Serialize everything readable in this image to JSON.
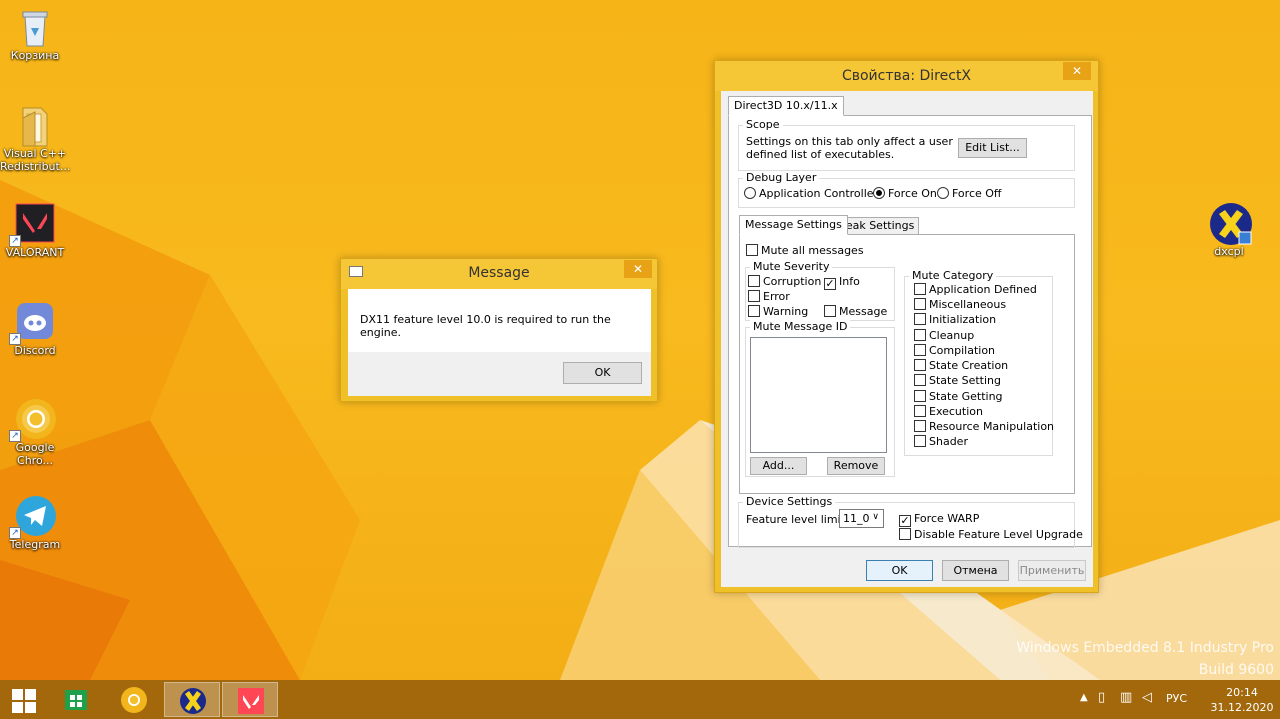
{
  "desktop": {
    "icons": [
      {
        "label": "Корзина"
      },
      {
        "label": "Visual C++ Redistribut..."
      },
      {
        "label": "VALORANT"
      },
      {
        "label": "Discord"
      },
      {
        "label": "Google Chro..."
      },
      {
        "label": "Telegram"
      },
      {
        "label": "dxcpl"
      }
    ],
    "watermark_line1": "Windows Embedded 8.1 Industry Pro",
    "watermark_line2": "Build 9600"
  },
  "message_box": {
    "title": "Message",
    "close": "✕",
    "text": "DX11 feature level 10.0 is required to run the engine.",
    "ok_label": "OK"
  },
  "dx_window": {
    "title": "Свойства: DirectX",
    "close": "✕",
    "main_tab": "Direct3D 10.x/11.x",
    "scope": {
      "label": "Scope",
      "text_line1": "Settings on this tab only affect a user",
      "text_line2": "defined list of executables.",
      "edit_list": "Edit List..."
    },
    "debug_layer": {
      "label": "Debug Layer",
      "options": [
        "Application Controlled",
        "Force On",
        "Force Off"
      ],
      "selected": "Force On"
    },
    "sub_tabs": [
      "Message Settings",
      "Break Settings"
    ],
    "mute_all": "Mute all messages",
    "mute_severity": {
      "label": "Mute Severity",
      "items": [
        {
          "label": "Corruption",
          "checked": false
        },
        {
          "label": "Info",
          "checked": true
        },
        {
          "label": "Error",
          "checked": false
        },
        {
          "label": "Warning",
          "checked": false
        },
        {
          "label": "Message",
          "checked": false
        }
      ]
    },
    "mute_message_id": {
      "label": "Mute Message ID",
      "add": "Add...",
      "remove": "Remove"
    },
    "mute_category": {
      "label": "Mute Category",
      "items": [
        "Application Defined",
        "Miscellaneous",
        "Initialization",
        "Cleanup",
        "Compilation",
        "State Creation",
        "State Setting",
        "State Getting",
        "Execution",
        "Resource Manipulation",
        "Shader"
      ]
    },
    "device_settings": {
      "label": "Device Settings",
      "feature_level_label": "Feature level limit:",
      "feature_level_value": "11_0",
      "force_warp": "Force WARP",
      "force_warp_checked": true,
      "disable_upgrade": "Disable Feature Level Upgrade",
      "disable_upgrade_checked": false
    },
    "buttons": {
      "ok": "OK",
      "cancel": "Отмена",
      "apply": "Применить"
    }
  },
  "taskbar": {
    "language": "РУС",
    "time": "20:14",
    "date": "31.12.2020"
  },
  "colors": {
    "wallpaper": "#f6b417",
    "window_frame": "#f0c028",
    "accent_blue": "#3c7fb1"
  }
}
